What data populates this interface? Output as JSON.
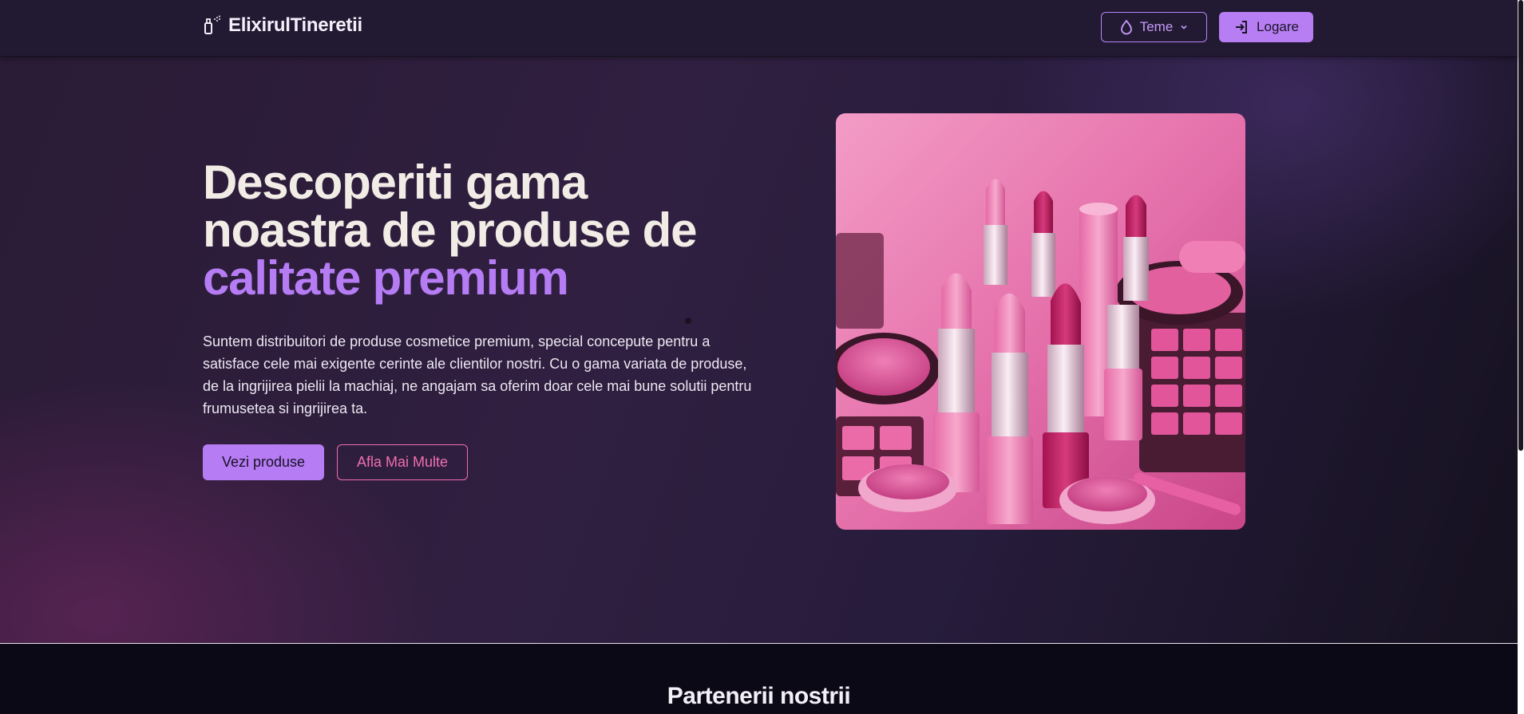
{
  "brand": {
    "name": "ElixirulTineretii",
    "icon": "spray-bottle-icon"
  },
  "header": {
    "theme_button": {
      "label": "Teme",
      "icon": "droplet-icon",
      "chevron": "chevron-down-icon"
    },
    "login_button": {
      "label": "Logare",
      "icon": "login-icon"
    }
  },
  "hero": {
    "title_line1": "Descoperiti gama",
    "title_line2": "noastra de produse de",
    "title_accent": "calitate premium",
    "description": "Suntem distribuitori de produse cosmetice premium, special concepute pentru a satisface cele mai exigente cerinte ale clientilor nostri. Cu o gama variata de produse, de la ingrijirea pielii la machiaj, ne angajam sa oferim doar cele mai bune solutii pentru frumusetea si ingrijirea ta.",
    "primary_button": "Vezi produse",
    "secondary_button": "Afla Mai Multe",
    "image": "lipstick-cosmetics-photo"
  },
  "partners": {
    "title": "Partenerii nostrii"
  },
  "colors": {
    "accent": "#b57cf4",
    "pink": "#ef6fb1",
    "header_bg": "#221a33",
    "hero_bg": "#2a1b36"
  }
}
